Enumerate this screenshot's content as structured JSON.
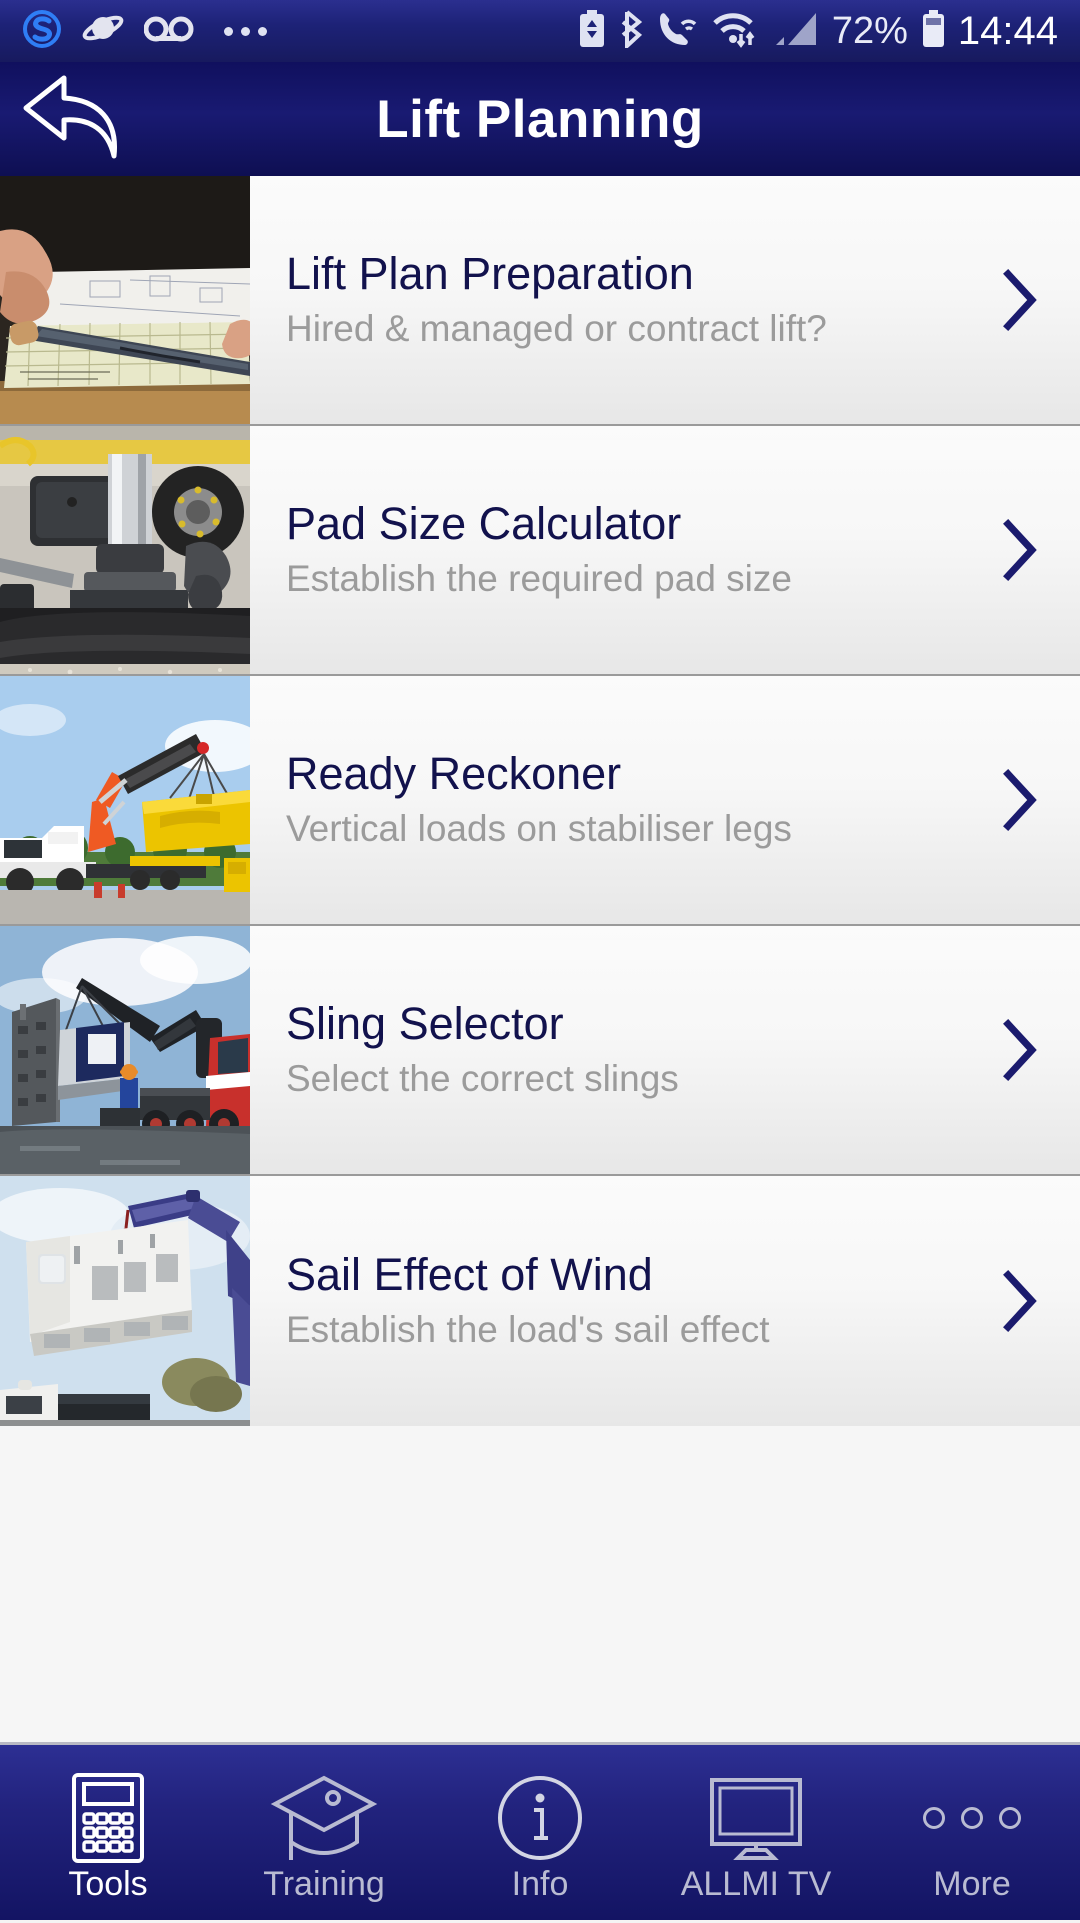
{
  "status_bar": {
    "left_icons": [
      "skype-app-icon",
      "samsung-internet-icon",
      "voicemail-icon",
      "more-notifications-icon"
    ],
    "right_icons": [
      "battery-saver-icon",
      "bluetooth-icon",
      "wifi-calling-icon",
      "wifi-data-icon",
      "signal-bars-icon",
      "battery-icon"
    ],
    "battery_percent": "72%",
    "clock": "14:44"
  },
  "header": {
    "back_icon": "back-arrow-icon",
    "title": "Lift Planning",
    "background_color": "#14145f",
    "title_color": "#ffffff"
  },
  "colors": {
    "brand_navy": "#12124d",
    "accent_chevron": "#1b1b6e",
    "subtitle_grey": "#9b9b9b",
    "row_divider": "#9a9a9a"
  },
  "menu": {
    "items": [
      {
        "title": "Lift Plan Preparation",
        "subtitle": "Hired & managed or contract lift?",
        "chevron_icon": "chevron-right-icon",
        "thumbnail": "lift-plan-drawing-thumbnail"
      },
      {
        "title": "Pad Size Calculator",
        "subtitle": "Establish the required pad size",
        "chevron_icon": "chevron-right-icon",
        "thumbnail": "stabiliser-pad-thumbnail"
      },
      {
        "title": "Ready Reckoner",
        "subtitle": "Vertical loads on stabiliser legs",
        "chevron_icon": "chevron-right-icon",
        "thumbnail": "orange-crane-yellow-beam-thumbnail"
      },
      {
        "title": "Sling Selector",
        "subtitle": "Select the correct slings",
        "chevron_icon": "chevron-right-icon",
        "thumbnail": "red-crane-cabin-lift-thumbnail"
      },
      {
        "title": "Sail Effect of Wind",
        "subtitle": "Establish the load's sail effect",
        "chevron_icon": "chevron-right-icon",
        "thumbnail": "blue-crane-generator-thumbnail"
      }
    ]
  },
  "tab_bar": {
    "tabs": [
      {
        "label": "Tools",
        "icon": "calculator-icon",
        "active": true
      },
      {
        "label": "Training",
        "icon": "graduation-cap-icon",
        "active": false
      },
      {
        "label": "Info",
        "icon": "info-circle-icon",
        "active": false
      },
      {
        "label": "ALLMI TV",
        "icon": "monitor-icon",
        "active": false
      },
      {
        "label": "More",
        "icon": "three-dots-icon",
        "active": false
      }
    ]
  }
}
